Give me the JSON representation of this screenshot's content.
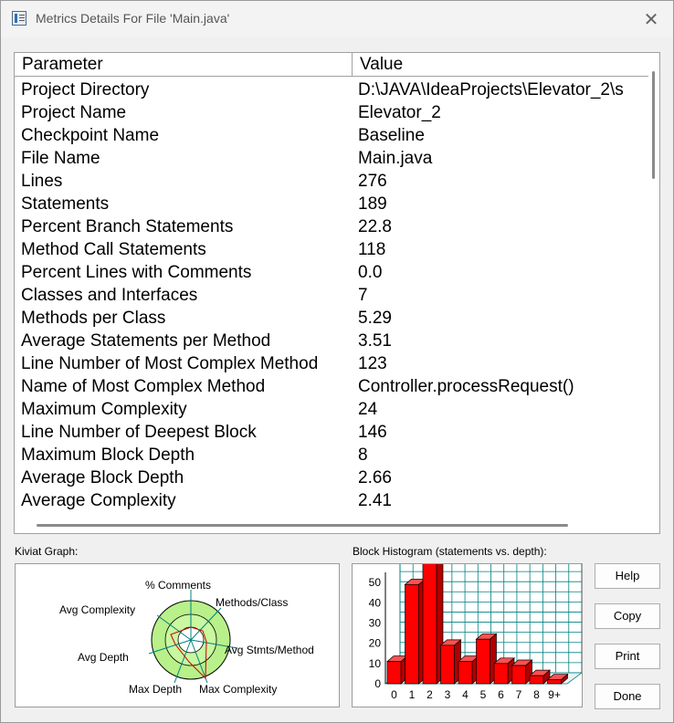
{
  "window": {
    "title": "Metrics Details For File 'Main.java'",
    "close_glyph": "✕"
  },
  "table": {
    "columns": [
      "Parameter",
      "Value"
    ],
    "rows": [
      [
        "Project Directory",
        "D:\\JAVA\\IdeaProjects\\Elevator_2\\s"
      ],
      [
        "Project Name",
        "Elevator_2"
      ],
      [
        "Checkpoint Name",
        "Baseline"
      ],
      [
        "File Name",
        "Main.java"
      ],
      [
        "Lines",
        "276"
      ],
      [
        "Statements",
        "189"
      ],
      [
        "Percent Branch Statements",
        "22.8"
      ],
      [
        "Method Call Statements",
        "118"
      ],
      [
        "Percent Lines with Comments",
        "0.0"
      ],
      [
        "Classes and Interfaces",
        "7"
      ],
      [
        "Methods per Class",
        "5.29"
      ],
      [
        "Average Statements per Method",
        "3.51"
      ],
      [
        "Line Number of Most Complex Method",
        "123"
      ],
      [
        "Name of Most Complex Method",
        "Controller.processRequest()"
      ],
      [
        "Maximum Complexity",
        "24"
      ],
      [
        "Line Number of Deepest Block",
        "146"
      ],
      [
        "Maximum Block Depth",
        "8"
      ],
      [
        "Average Block Depth",
        "2.66"
      ],
      [
        "Average Complexity",
        "2.41"
      ]
    ]
  },
  "kiviat": {
    "label": "Kiviat Graph:",
    "axes": [
      "% Comments",
      "Methods/Class",
      "Avg Stmts/Method",
      "Max Complexity",
      "Max Depth",
      "Avg Depth",
      "Avg Complexity"
    ]
  },
  "histogram": {
    "label": "Block Histogram (statements vs. depth):",
    "y_ticks": [
      "0",
      "10",
      "20",
      "30",
      "40",
      "50"
    ],
    "x_ticks": [
      "0",
      "1",
      "2",
      "3",
      "4",
      "5",
      "6",
      "7",
      "8",
      "9+"
    ]
  },
  "chart_data": {
    "type": "bar",
    "title": "Block Histogram (statements vs. depth):",
    "categories": [
      "0",
      "1",
      "2",
      "3",
      "4",
      "5",
      "6",
      "7",
      "8",
      "9+"
    ],
    "values": [
      11,
      49,
      60,
      19,
      11,
      22,
      10,
      9,
      4,
      2
    ],
    "ylim": [
      0,
      55
    ],
    "grid": true
  },
  "buttons": {
    "help": "Help",
    "copy": "Copy",
    "print": "Print",
    "done": "Done"
  },
  "colors": {
    "bar": "#ff0000",
    "kiviat_fill": "#b8f08a",
    "grid": "#008080"
  }
}
